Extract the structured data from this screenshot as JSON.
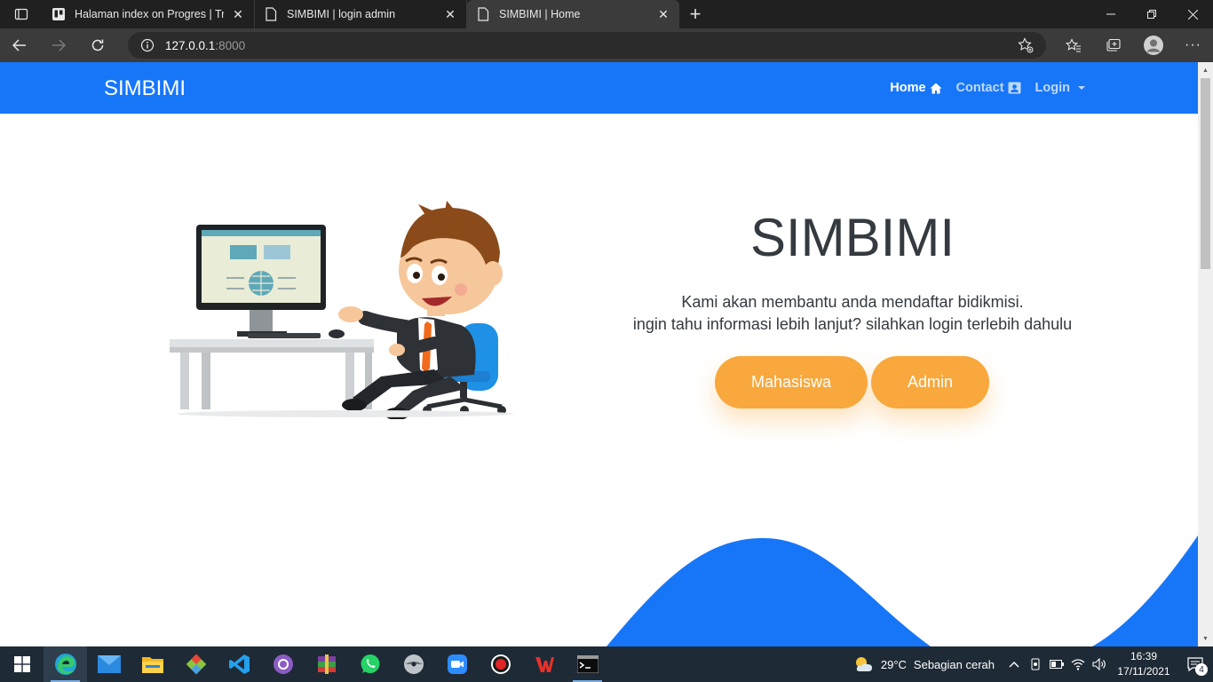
{
  "browser": {
    "tabs": [
      {
        "title": "Halaman index on Progres | Trello",
        "active": false
      },
      {
        "title": "SIMBIMI | login admin",
        "active": false
      },
      {
        "title": "SIMBIMI | Home",
        "active": true
      }
    ],
    "address": {
      "host": "127.0.0.1",
      "port": ":8000"
    }
  },
  "navbar": {
    "brand": "SIMBIMI",
    "links": [
      {
        "label": "Home",
        "icon": "home-icon",
        "active": true
      },
      {
        "label": "Contact",
        "icon": "contact-card-icon",
        "active": false
      },
      {
        "label": "Login",
        "icon": "caret-down-icon",
        "active": false
      }
    ]
  },
  "hero": {
    "title": "SIMBIMI",
    "line1": "Kami akan membantu anda mendaftar bidikmisi.",
    "line2": "ingin tahu informasi lebih lanjut? silahkan login terlebih dahulu",
    "buttons": [
      {
        "label": "Mahasiswa"
      },
      {
        "label": "Admin"
      }
    ],
    "illustration": "businessman-at-computer-illustration"
  },
  "taskbar": {
    "apps": [
      "windows-start-icon",
      "edge-icon",
      "mail-icon",
      "file-explorer-icon",
      "git-icon",
      "vscode-icon",
      "github-desktop-icon",
      "winrar-icon",
      "whatsapp-icon",
      "disc-burner-icon",
      "zoom-icon",
      "screen-recorder-icon",
      "wps-office-icon",
      "terminal-icon"
    ],
    "weather": {
      "temp": "29°C",
      "desc": "Sebagian cerah"
    },
    "time": "16:39",
    "date": "17/11/2021",
    "notifications": "4"
  },
  "colors": {
    "primary": "#1776f8",
    "accent": "#f8a83c",
    "text": "#343a40"
  }
}
